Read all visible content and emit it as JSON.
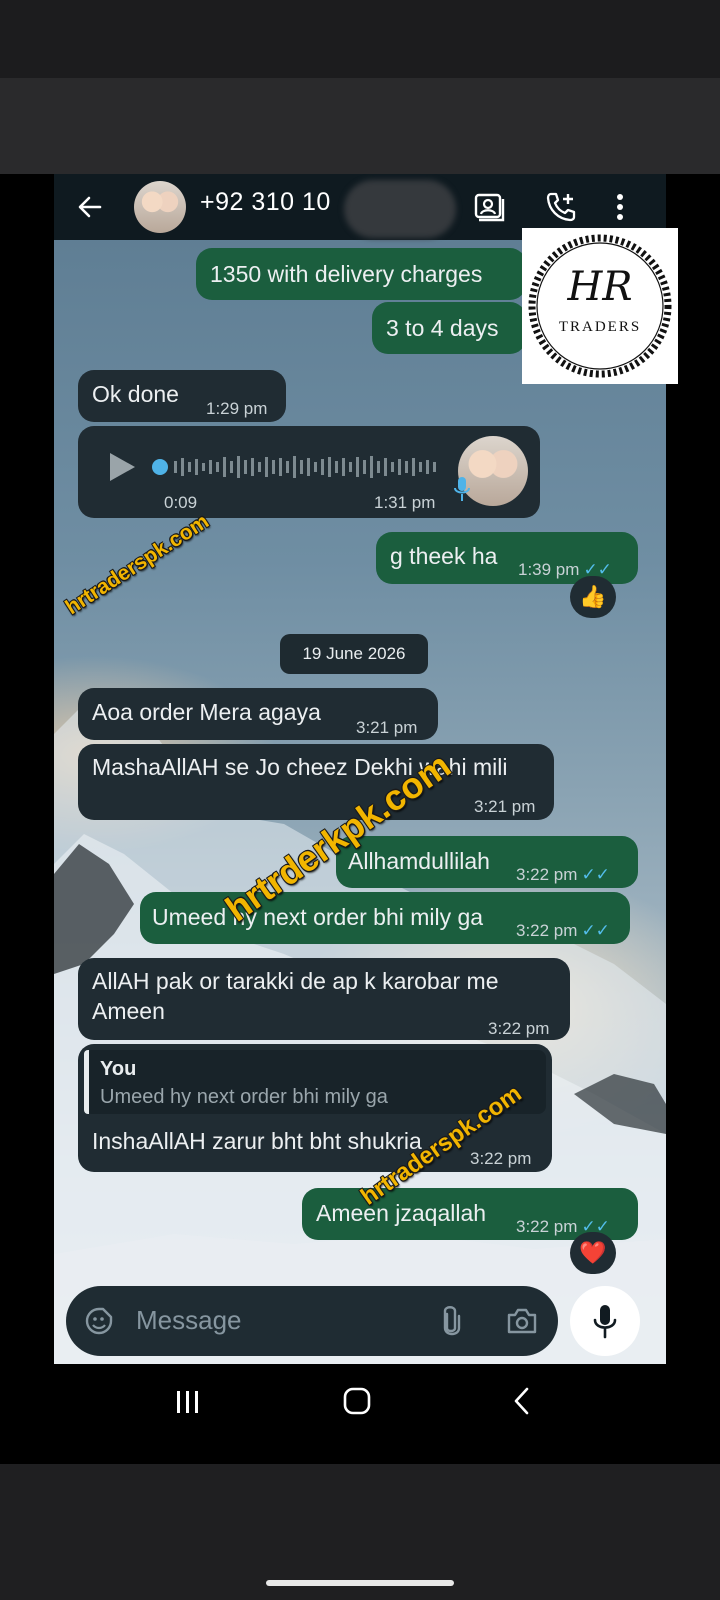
{
  "header": {
    "contact_number": "+92 310 10",
    "actions": [
      "video-call",
      "add-call",
      "more-options"
    ]
  },
  "messages": {
    "m1": {
      "text": "1350 with delivery charges"
    },
    "m2": {
      "text": "3 to 4 days"
    },
    "m3": {
      "text": "Ok done",
      "time": "1:29 pm"
    },
    "voice": {
      "duration": "0:09",
      "time": "1:31 pm"
    },
    "m4": {
      "text": "g theek ha",
      "time": "1:39 pm",
      "reaction": "👍"
    },
    "date_divider": "19 June 2026",
    "m5": {
      "text": "Aoa order Mera agaya",
      "time": "3:21 pm"
    },
    "m6": {
      "text": "MashaAllAH se Jo cheez Dekhi wahi mili",
      "time": "3:21 pm"
    },
    "m7": {
      "text": "Allhamdullilah",
      "time": "3:22 pm"
    },
    "m8": {
      "text": "Umeed hy next order bhi mily ga",
      "time": "3:22 pm"
    },
    "m9": {
      "line1": "AllAH pak or tarakki de ap k karobar me",
      "line2": "Ameen",
      "time": "3:22 pm"
    },
    "m10": {
      "quote_author": "You",
      "quote_text": "Umeed hy next order bhi mily ga",
      "text": "InshaAllAH zarur bht bht shukria",
      "time": "3:22 pm"
    },
    "m11": {
      "text": "Ameen  jzaqallah",
      "time": "3:22 pm",
      "reaction": "❤️"
    }
  },
  "composer": {
    "placeholder": "Message"
  },
  "watermarks": {
    "w1": "hrtraderspk.com",
    "w2": "hrtrderkpk.com",
    "w3": "hrtraderspk.com"
  },
  "logo": {
    "monogram": "HR",
    "name": "TRADERS"
  },
  "colors": {
    "outgoing_bubble": "#1b5e3e",
    "incoming_bubble": "#202c33",
    "read_ticks": "#53bdeb",
    "watermark": "#f2b500"
  }
}
